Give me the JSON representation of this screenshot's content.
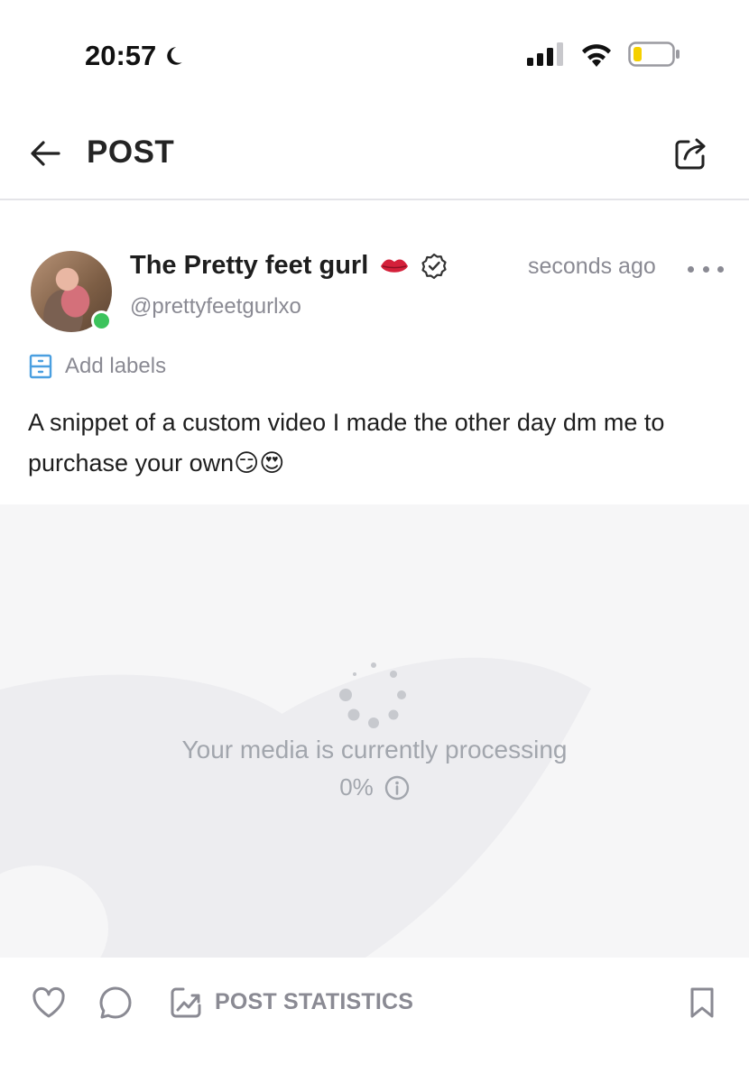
{
  "status_bar": {
    "time": "20:57"
  },
  "header": {
    "title": "POST"
  },
  "post": {
    "author_name": "The Pretty feet gurl",
    "author_handle": "@prettyfeetgurlxo",
    "timestamp": "seconds ago",
    "add_labels": "Add labels",
    "text": "A snippet of a custom video I made the other day dm me to purchase your own😏😍"
  },
  "media": {
    "status": "Your media is currently processing",
    "progress_text": "0%",
    "progress": 0
  },
  "footer": {
    "stats_label": "POST STATISTICS"
  },
  "icons": [
    "moon-icon",
    "signal-icon",
    "wifi-icon",
    "battery-icon",
    "back-arrow-icon",
    "share-icon",
    "lips-icon",
    "verified-icon",
    "more-icon",
    "labels-icon",
    "spinner-icon",
    "info-icon",
    "heart-icon",
    "comment-icon",
    "statistics-icon",
    "bookmark-icon"
  ],
  "colors": {
    "online": "#3cc35c",
    "label_icon": "#4a9fe0",
    "muted": "#8a8a93",
    "battery_low": "#f5d000"
  }
}
